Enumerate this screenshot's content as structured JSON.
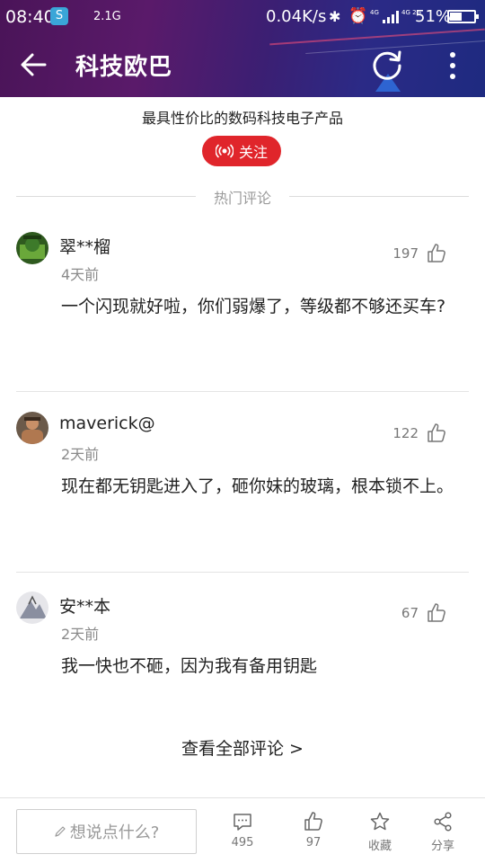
{
  "status_bar": {
    "time": "08:40",
    "app_badge": "S",
    "traffic": "2.1G",
    "net_speed": "0.04K/s",
    "network_1": "4G",
    "network_2": "4G 2G",
    "battery_pct": "51%",
    "battery_level": 0.51
  },
  "app_bar": {
    "title": "科技欧巴",
    "icons": [
      "back-arrow-icon",
      "refresh-icon",
      "more-vertical-icon"
    ]
  },
  "channel": {
    "tagline": "最具性价比的数码科技电子产品",
    "follow_label": "关注"
  },
  "section": {
    "title": "热门评论"
  },
  "comments": [
    {
      "user": "翠**榴",
      "time": "4天前",
      "likes": "197",
      "text": "一个闪现就好啦，你们弱爆了，等级都不够还买车?"
    },
    {
      "user": "maverick@",
      "time": "2天前",
      "likes": "122",
      "text": "现在都无钥匙进入了，砸你妹的玻璃，根本锁不上。"
    },
    {
      "user": "安**本",
      "time": "2天前",
      "likes": "67",
      "text": "我一快也不砸，因为我有备用钥匙"
    }
  ],
  "view_all": "查看全部评论 >",
  "bottom_bar": {
    "input_placeholder": "想说点什么?",
    "comment_count": "495",
    "like_count": "97",
    "favorite_label": "收藏",
    "share_label": "分享"
  },
  "colors": {
    "accent_red": "#e0252b",
    "header_gradient_start": "#4a1458",
    "header_gradient_end": "#1e2a80"
  }
}
